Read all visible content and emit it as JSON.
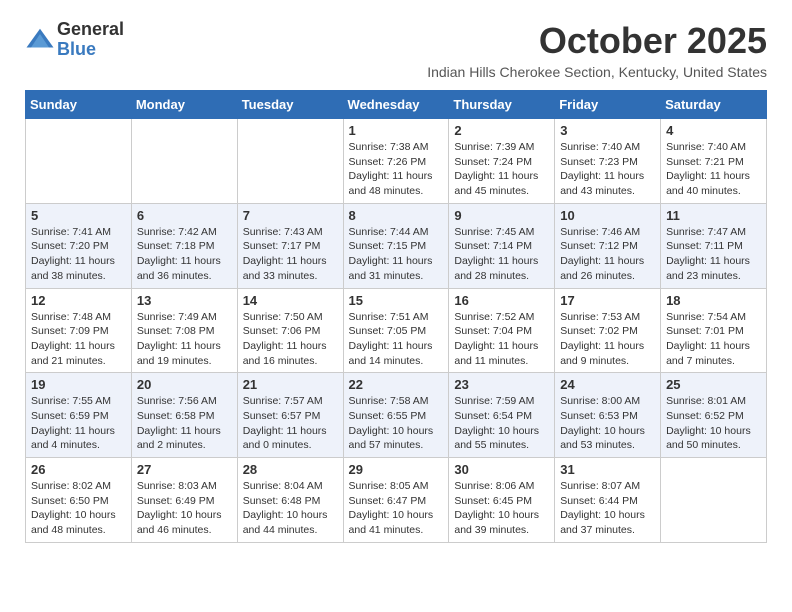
{
  "logo": {
    "general": "General",
    "blue": "Blue"
  },
  "title": "October 2025",
  "subtitle": "Indian Hills Cherokee Section, Kentucky, United States",
  "days_of_week": [
    "Sunday",
    "Monday",
    "Tuesday",
    "Wednesday",
    "Thursday",
    "Friday",
    "Saturday"
  ],
  "weeks": [
    {
      "days": [
        {
          "num": "",
          "info": ""
        },
        {
          "num": "",
          "info": ""
        },
        {
          "num": "",
          "info": ""
        },
        {
          "num": "1",
          "info": "Sunrise: 7:38 AM\nSunset: 7:26 PM\nDaylight: 11 hours\nand 48 minutes."
        },
        {
          "num": "2",
          "info": "Sunrise: 7:39 AM\nSunset: 7:24 PM\nDaylight: 11 hours\nand 45 minutes."
        },
        {
          "num": "3",
          "info": "Sunrise: 7:40 AM\nSunset: 7:23 PM\nDaylight: 11 hours\nand 43 minutes."
        },
        {
          "num": "4",
          "info": "Sunrise: 7:40 AM\nSunset: 7:21 PM\nDaylight: 11 hours\nand 40 minutes."
        }
      ]
    },
    {
      "days": [
        {
          "num": "5",
          "info": "Sunrise: 7:41 AM\nSunset: 7:20 PM\nDaylight: 11 hours\nand 38 minutes."
        },
        {
          "num": "6",
          "info": "Sunrise: 7:42 AM\nSunset: 7:18 PM\nDaylight: 11 hours\nand 36 minutes."
        },
        {
          "num": "7",
          "info": "Sunrise: 7:43 AM\nSunset: 7:17 PM\nDaylight: 11 hours\nand 33 minutes."
        },
        {
          "num": "8",
          "info": "Sunrise: 7:44 AM\nSunset: 7:15 PM\nDaylight: 11 hours\nand 31 minutes."
        },
        {
          "num": "9",
          "info": "Sunrise: 7:45 AM\nSunset: 7:14 PM\nDaylight: 11 hours\nand 28 minutes."
        },
        {
          "num": "10",
          "info": "Sunrise: 7:46 AM\nSunset: 7:12 PM\nDaylight: 11 hours\nand 26 minutes."
        },
        {
          "num": "11",
          "info": "Sunrise: 7:47 AM\nSunset: 7:11 PM\nDaylight: 11 hours\nand 23 minutes."
        }
      ]
    },
    {
      "days": [
        {
          "num": "12",
          "info": "Sunrise: 7:48 AM\nSunset: 7:09 PM\nDaylight: 11 hours\nand 21 minutes."
        },
        {
          "num": "13",
          "info": "Sunrise: 7:49 AM\nSunset: 7:08 PM\nDaylight: 11 hours\nand 19 minutes."
        },
        {
          "num": "14",
          "info": "Sunrise: 7:50 AM\nSunset: 7:06 PM\nDaylight: 11 hours\nand 16 minutes."
        },
        {
          "num": "15",
          "info": "Sunrise: 7:51 AM\nSunset: 7:05 PM\nDaylight: 11 hours\nand 14 minutes."
        },
        {
          "num": "16",
          "info": "Sunrise: 7:52 AM\nSunset: 7:04 PM\nDaylight: 11 hours\nand 11 minutes."
        },
        {
          "num": "17",
          "info": "Sunrise: 7:53 AM\nSunset: 7:02 PM\nDaylight: 11 hours\nand 9 minutes."
        },
        {
          "num": "18",
          "info": "Sunrise: 7:54 AM\nSunset: 7:01 PM\nDaylight: 11 hours\nand 7 minutes."
        }
      ]
    },
    {
      "days": [
        {
          "num": "19",
          "info": "Sunrise: 7:55 AM\nSunset: 6:59 PM\nDaylight: 11 hours\nand 4 minutes."
        },
        {
          "num": "20",
          "info": "Sunrise: 7:56 AM\nSunset: 6:58 PM\nDaylight: 11 hours\nand 2 minutes."
        },
        {
          "num": "21",
          "info": "Sunrise: 7:57 AM\nSunset: 6:57 PM\nDaylight: 11 hours\nand 0 minutes."
        },
        {
          "num": "22",
          "info": "Sunrise: 7:58 AM\nSunset: 6:55 PM\nDaylight: 10 hours\nand 57 minutes."
        },
        {
          "num": "23",
          "info": "Sunrise: 7:59 AM\nSunset: 6:54 PM\nDaylight: 10 hours\nand 55 minutes."
        },
        {
          "num": "24",
          "info": "Sunrise: 8:00 AM\nSunset: 6:53 PM\nDaylight: 10 hours\nand 53 minutes."
        },
        {
          "num": "25",
          "info": "Sunrise: 8:01 AM\nSunset: 6:52 PM\nDaylight: 10 hours\nand 50 minutes."
        }
      ]
    },
    {
      "days": [
        {
          "num": "26",
          "info": "Sunrise: 8:02 AM\nSunset: 6:50 PM\nDaylight: 10 hours\nand 48 minutes."
        },
        {
          "num": "27",
          "info": "Sunrise: 8:03 AM\nSunset: 6:49 PM\nDaylight: 10 hours\nand 46 minutes."
        },
        {
          "num": "28",
          "info": "Sunrise: 8:04 AM\nSunset: 6:48 PM\nDaylight: 10 hours\nand 44 minutes."
        },
        {
          "num": "29",
          "info": "Sunrise: 8:05 AM\nSunset: 6:47 PM\nDaylight: 10 hours\nand 41 minutes."
        },
        {
          "num": "30",
          "info": "Sunrise: 8:06 AM\nSunset: 6:45 PM\nDaylight: 10 hours\nand 39 minutes."
        },
        {
          "num": "31",
          "info": "Sunrise: 8:07 AM\nSunset: 6:44 PM\nDaylight: 10 hours\nand 37 minutes."
        },
        {
          "num": "",
          "info": ""
        }
      ]
    }
  ]
}
